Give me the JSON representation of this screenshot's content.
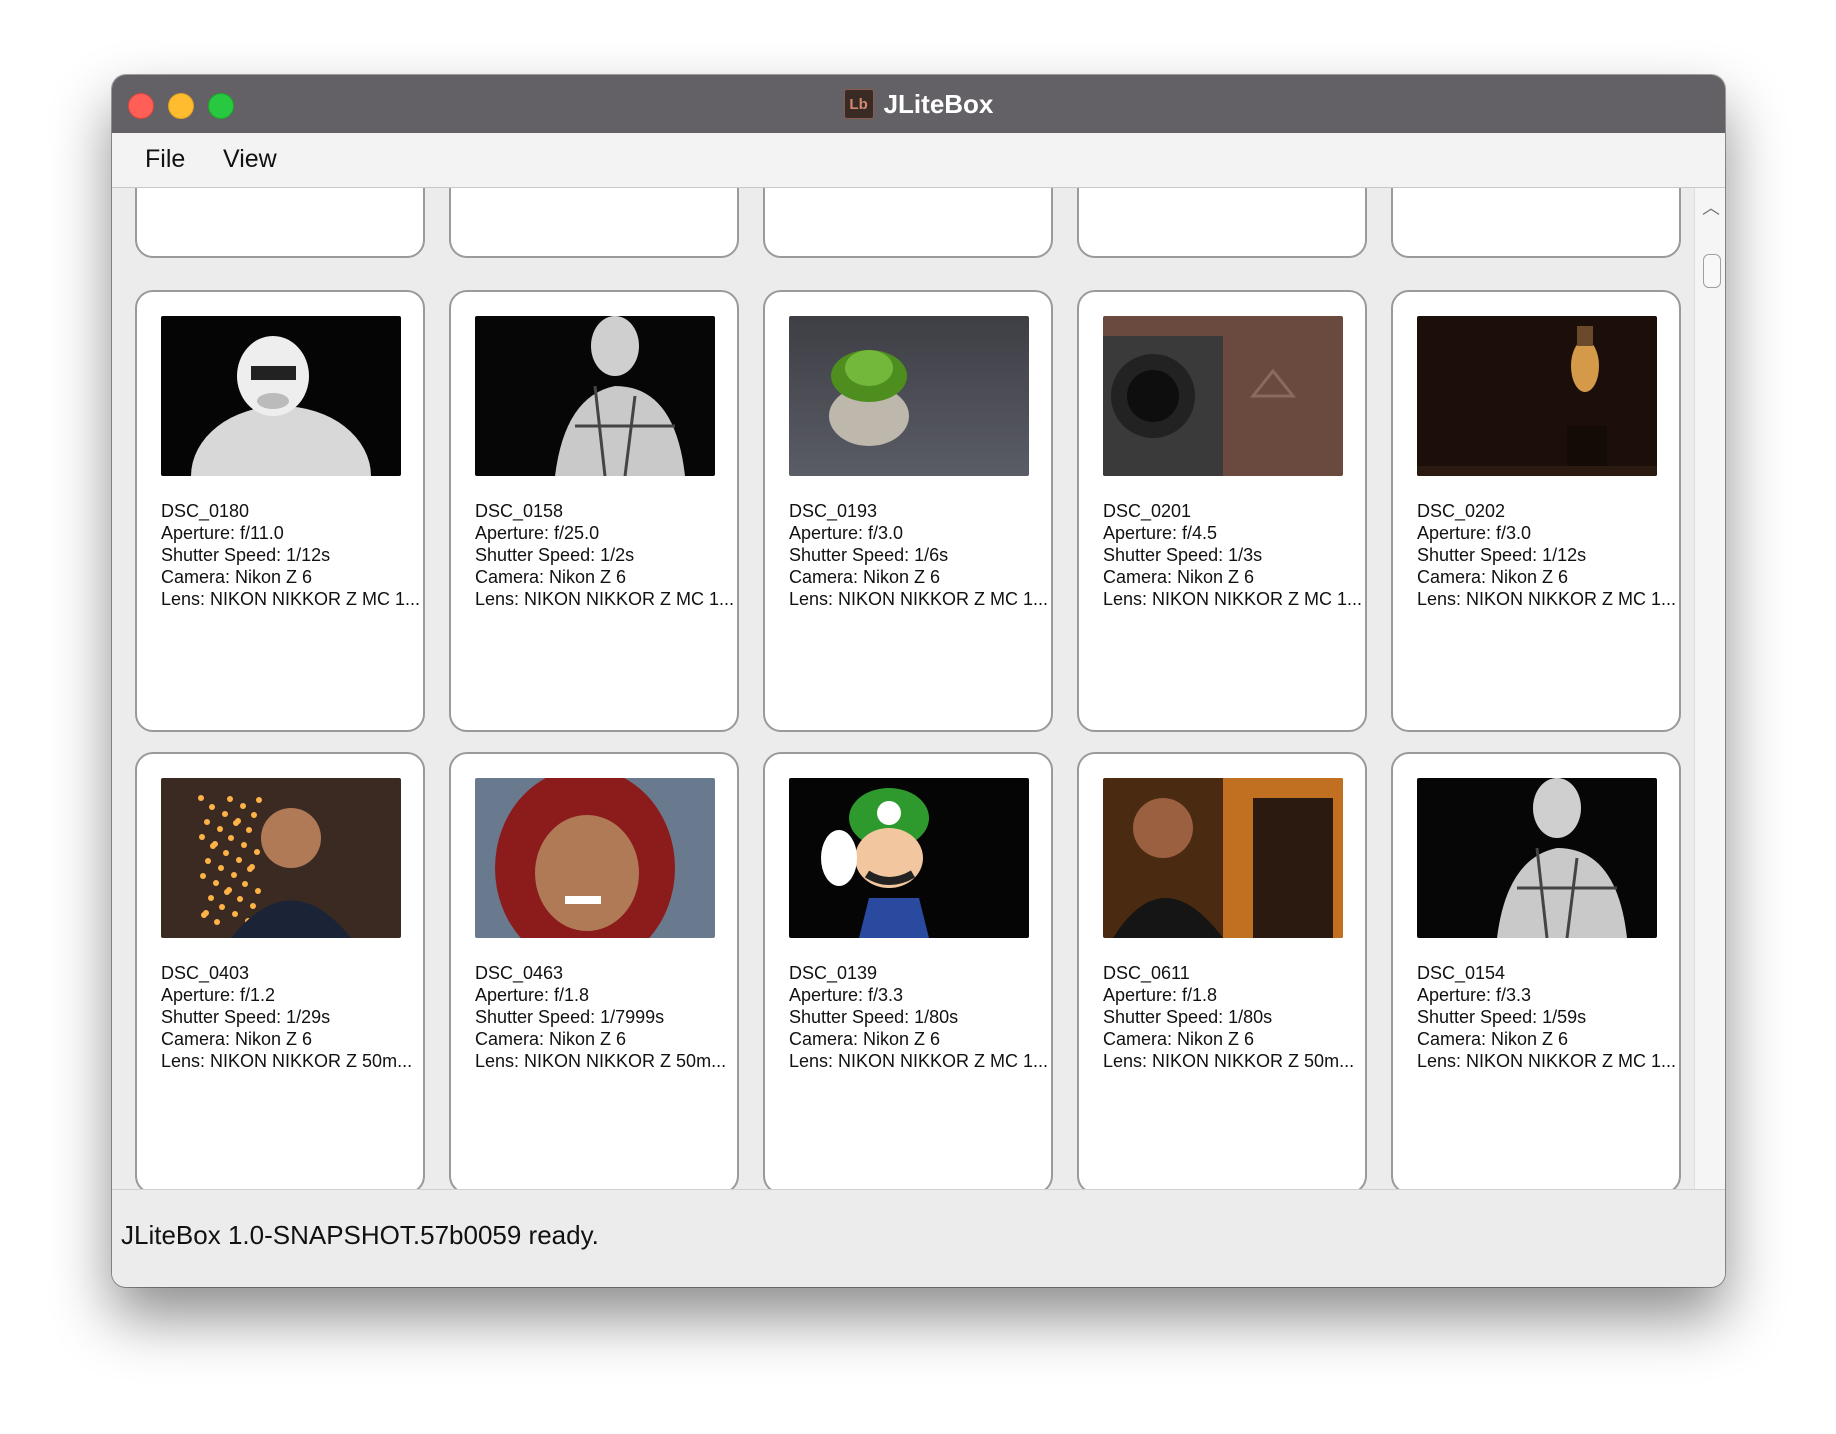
{
  "window": {
    "title": "JLiteBox",
    "app_icon_text": "Lb"
  },
  "menu": {
    "items": [
      "File",
      "View"
    ]
  },
  "cards": [
    {
      "name": "DSC_0180",
      "aperture": "Aperture: f/11.0",
      "shutter": "Shutter Speed: 1/12s",
      "camera": "Camera: Nikon Z 6",
      "lens": "Lens: NIKON NIKKOR Z MC 1...",
      "photo": "stormtrooper"
    },
    {
      "name": "DSC_0158",
      "aperture": "Aperture: f/25.0",
      "shutter": "Shutter Speed: 1/2s",
      "camera": "Camera: Nikon Z 6",
      "lens": "Lens: NIKON NIKKOR Z MC 1...",
      "photo": "figure-mannequin"
    },
    {
      "name": "DSC_0193",
      "aperture": "Aperture: f/3.0",
      "shutter": "Shutter Speed: 1/6s",
      "camera": "Camera: Nikon Z 6",
      "lens": "Lens: NIKON NIKKOR Z MC 1...",
      "photo": "plant-pot"
    },
    {
      "name": "DSC_0201",
      "aperture": "Aperture: f/4.5",
      "shutter": "Shutter Speed: 1/3s",
      "camera": "Camera: Nikon Z 6",
      "lens": "Lens: NIKON NIKKOR Z MC 1...",
      "photo": "camera-lens"
    },
    {
      "name": "DSC_0202",
      "aperture": "Aperture: f/3.0",
      "shutter": "Shutter Speed: 1/12s",
      "camera": "Camera: Nikon Z 6",
      "lens": "Lens: NIKON NIKKOR Z MC 1...",
      "photo": "edison-bulb"
    },
    {
      "name": "DSC_0403",
      "aperture": "Aperture: f/1.2",
      "shutter": "Shutter Speed: 1/29s",
      "camera": "Camera: Nikon Z 6",
      "lens": "Lens: NIKON NIKKOR Z 50m...",
      "photo": "boy-christmas-tree"
    },
    {
      "name": "DSC_0463",
      "aperture": "Aperture: f/1.8",
      "shutter": "Shutter Speed: 1/7999s",
      "camera": "Camera: Nikon Z 6",
      "lens": "Lens: NIKON NIKKOR Z 50m...",
      "photo": "child-red-hood"
    },
    {
      "name": "DSC_0139",
      "aperture": "Aperture: f/3.3",
      "shutter": "Shutter Speed: 1/80s",
      "camera": "Camera: Nikon Z 6",
      "lens": "Lens: NIKON NIKKOR Z MC 1...",
      "photo": "luigi-figure"
    },
    {
      "name": "DSC_0611",
      "aperture": "Aperture: f/1.8",
      "shutter": "Shutter Speed: 1/80s",
      "camera": "Camera: Nikon Z 6",
      "lens": "Lens: NIKON NIKKOR Z 50m...",
      "photo": "boy-piano"
    },
    {
      "name": "DSC_0154",
      "aperture": "Aperture: f/3.3",
      "shutter": "Shutter Speed: 1/59s",
      "camera": "Camera: Nikon Z 6",
      "lens": "Lens: NIKON NIKKOR Z MC 1...",
      "photo": "figure-mannequin"
    }
  ],
  "status": {
    "text": "JLiteBox 1.0-SNAPSHOT.57b0059 ready."
  }
}
